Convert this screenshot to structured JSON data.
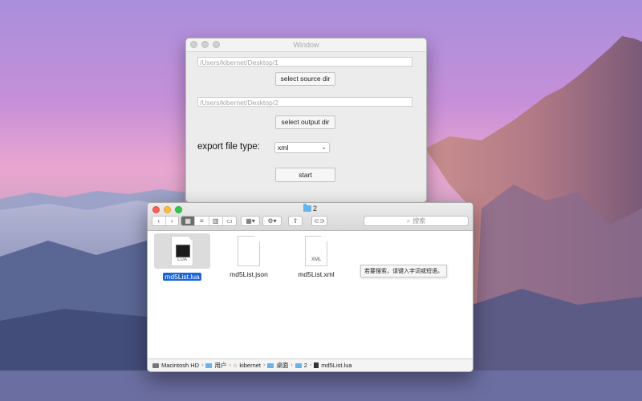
{
  "colors": {
    "accent": "#1c65d4",
    "folder": "#68b3ea",
    "traffic_red": "#fc605c",
    "traffic_yellow": "#fdbc40",
    "traffic_green": "#34c84a"
  },
  "app_window": {
    "title": "Window",
    "source_path": "/Users/kibernet/Desktop/1",
    "select_source_label": "select source dir",
    "output_path": "/Users/kibernet/Desktop/2",
    "select_output_label": "select output dir",
    "export_type_label": "export file type:",
    "export_type_value": "xml",
    "start_label": "start"
  },
  "finder": {
    "title": "2",
    "search_placeholder": "搜索",
    "search_tooltip": "若要搜索，请键入字词或短语。",
    "toolbar_icons": [
      "chevron-left-icon",
      "chevron-right-icon",
      "icon-view-icon",
      "list-view-icon",
      "column-view-icon",
      "cover-flow-icon",
      "arrange-icon",
      "gear-icon",
      "share-icon",
      "tag-icon"
    ],
    "files": [
      {
        "name": "md5List.lua",
        "badge": "LUA",
        "selected": true
      },
      {
        "name": "md5List.json",
        "badge": "",
        "selected": false
      },
      {
        "name": "md5List.xml",
        "badge": "XML",
        "selected": false
      }
    ],
    "path": [
      "Macintosh HD",
      "用户",
      "kibernet",
      "桌面",
      "2",
      "md5List.lua"
    ]
  }
}
